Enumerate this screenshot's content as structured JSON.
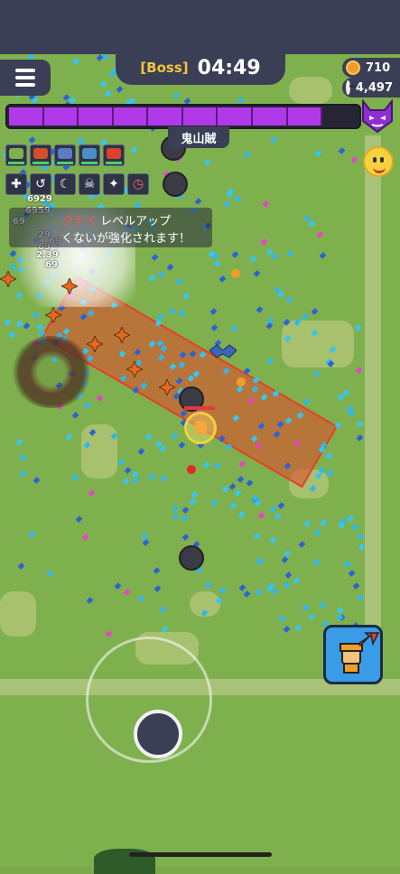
{
  "header": {
    "boss_tag": "[Boss]",
    "timer": "04:49"
  },
  "stats": {
    "coins": "710",
    "kills": "4,497"
  },
  "boss": {
    "name": "鬼山賊",
    "health_fraction": 0.9,
    "segments": 9
  },
  "level_up": {
    "skill_name": "クナイ",
    "title_suffix": "レベルアップ",
    "message": "くないが強化されます！"
  },
  "skills_row1": [
    "kunai-icon",
    "ant-icon",
    "wolf-icon",
    "dragon-icon",
    "pyramid-icon"
  ],
  "skills_row2": [
    "cross-icon",
    "swirl-icon",
    "moon-icon",
    "skull-icon",
    "feather-icon",
    "clock-icon"
  ],
  "damage_numbers": [
    "6929",
    "69",
    "6959",
    "29",
    "69",
    "69",
    "2.39",
    "69"
  ],
  "colors": {
    "boss_bar": "#b03ae8",
    "panel": "#3a3f55",
    "grass": "#7fb04e",
    "beam": "#e4412a"
  }
}
